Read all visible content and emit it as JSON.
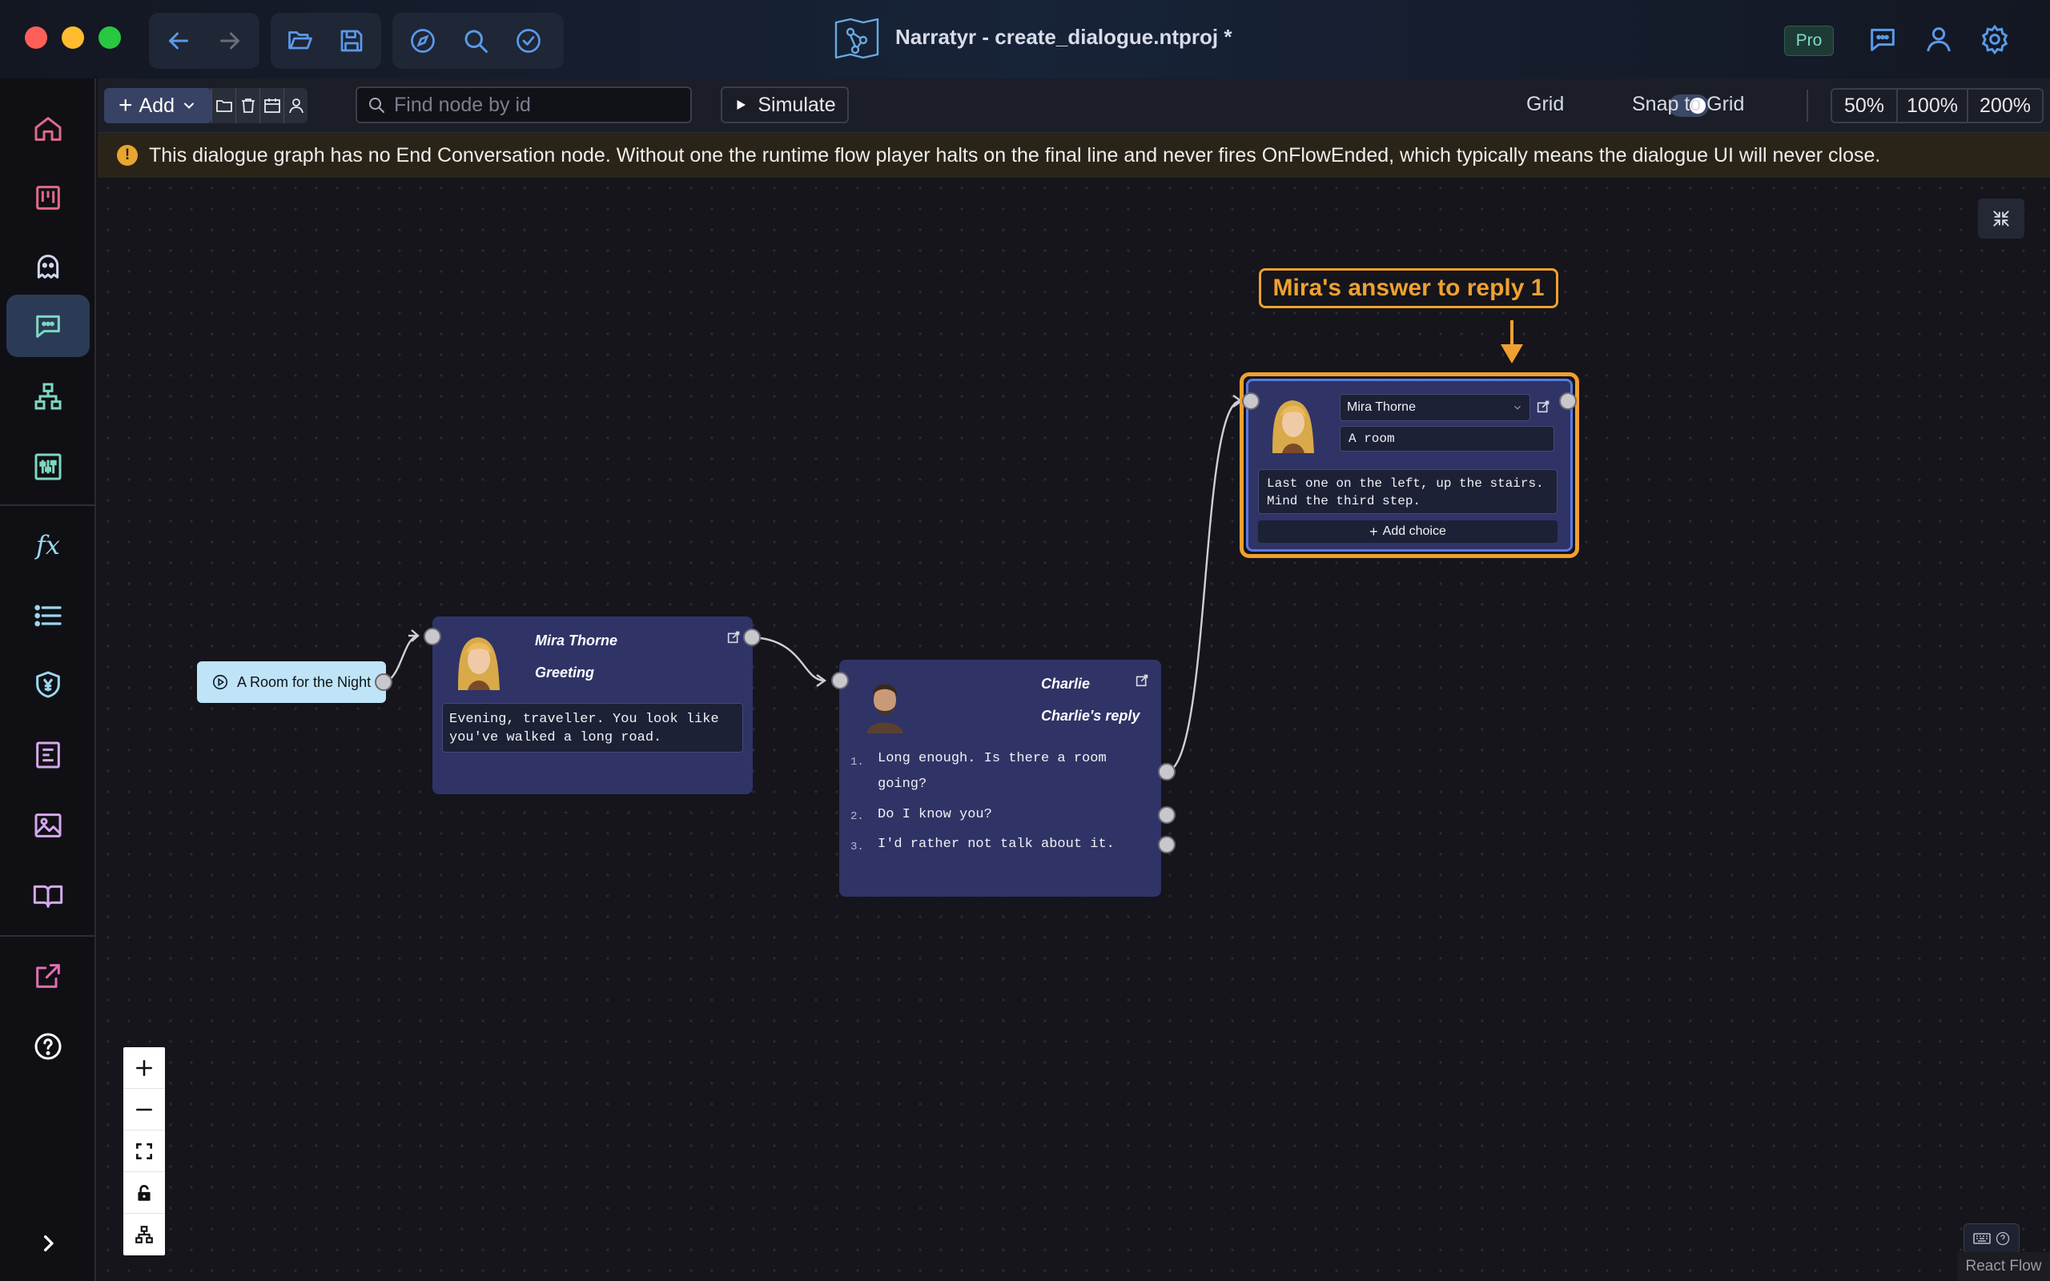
{
  "window": {
    "title": "Narratyr - create_dialogue.ntproj *",
    "badge": "Pro"
  },
  "toolbar": {
    "add_label": "Add",
    "search_placeholder": "Find node by id",
    "simulate_label": "Simulate",
    "grid_label": "Grid",
    "grid_on": true,
    "snap_label": "Snap to Grid",
    "snap_on": true,
    "zoom_50": "50%",
    "zoom_100": "100%",
    "zoom_200": "200%"
  },
  "warning": {
    "text": "This dialogue graph has no End Conversation node. Without one the runtime flow player halts on the final line and never fires OnFlowEnded, which typically means the dialogue UI will never close."
  },
  "canvas": {
    "start_node": {
      "label": "A Room for the Night"
    },
    "greeting_node": {
      "speaker": "Mira Thorne",
      "title": "Greeting",
      "text": "Evening, traveller. You look like you've walked a long road."
    },
    "reply_node": {
      "speaker": "Charlie",
      "title": "Charlie's reply",
      "choices": [
        {
          "num": "1.",
          "text": "Long enough. Is there a room going?"
        },
        {
          "num": "2.",
          "text": "Do I know you?"
        },
        {
          "num": "3.",
          "text": "I'd rather not talk about it."
        }
      ]
    },
    "answer_node": {
      "speaker": "Mira Thorne",
      "title": "A room",
      "text": "Last one on the left, up the stairs. Mind the third step.",
      "add_choice": "Add choice"
    },
    "callout": "Mira's answer to reply 1",
    "attribution": "React Flow"
  },
  "colors": {
    "accent": "#f0a030",
    "node_bg": "#2f3366",
    "warning_bg": "#2a2418",
    "sidebar_active": "#2b3b57"
  }
}
